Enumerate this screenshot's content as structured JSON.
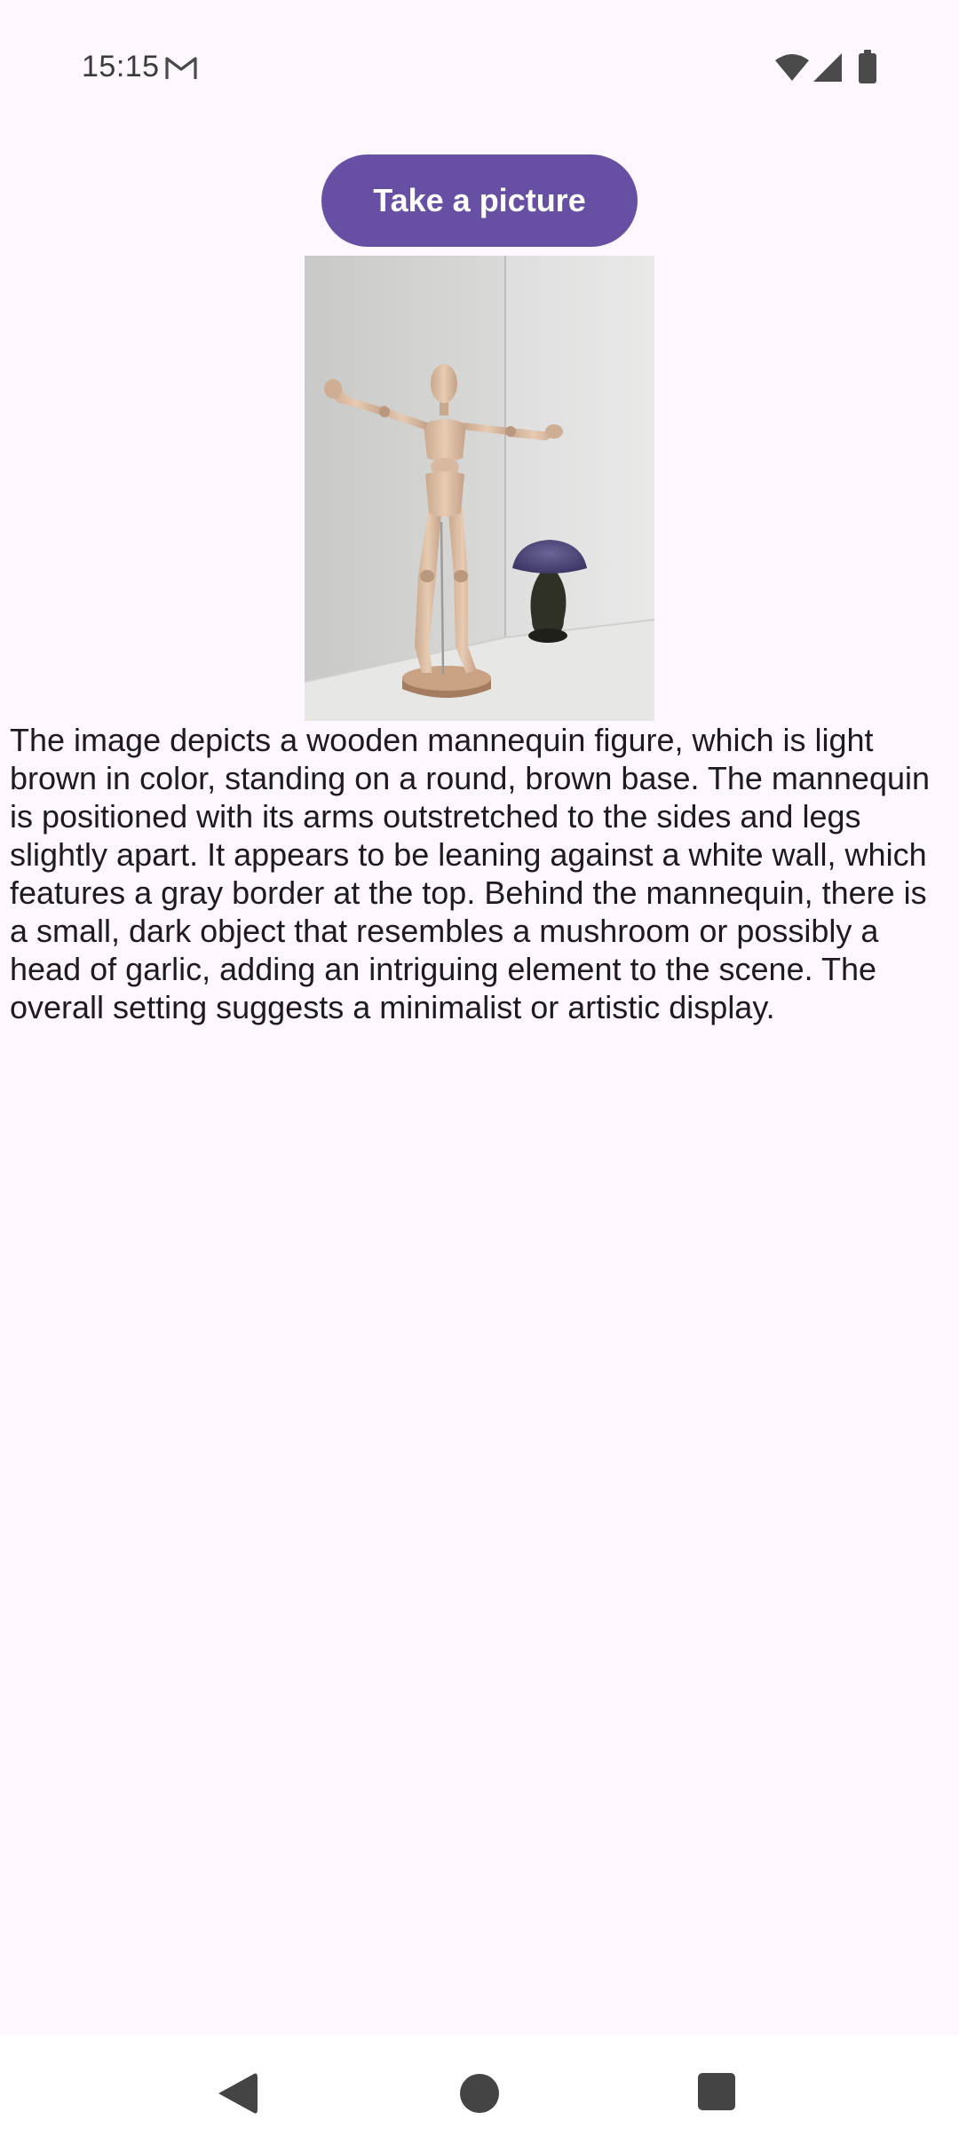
{
  "status_bar": {
    "time": "15:15",
    "notification_icon": "gmail-icon",
    "wifi_icon": "wifi-icon",
    "signal_icon": "signal-icon",
    "battery_icon": "battery-icon"
  },
  "main": {
    "take_picture_label": "Take a picture",
    "photo_alt": "captured photo",
    "description": "The image depicts a wooden mannequin figure, which is light brown in color, standing on a round, brown base. The mannequin is positioned with its arms outstretched to the sides and legs slightly apart. It appears to be leaning against a white wall, which features a gray border at the top. Behind the mannequin, there is a small, dark object that resembles a mushroom or possibly a head of garlic, adding an intriguing element to the scene. The overall setting suggests a minimalist or artistic display."
  },
  "nav_bar": {
    "back_icon": "back-icon",
    "home_icon": "home-icon",
    "recents_icon": "recents-icon"
  },
  "colors": {
    "background": "#FEF7FF",
    "primary": "#6750A4",
    "on_primary": "#FFFFFF",
    "text": "#1D1B20",
    "nav_bar": "#FFFFFF",
    "nav_icon": "#444444"
  }
}
